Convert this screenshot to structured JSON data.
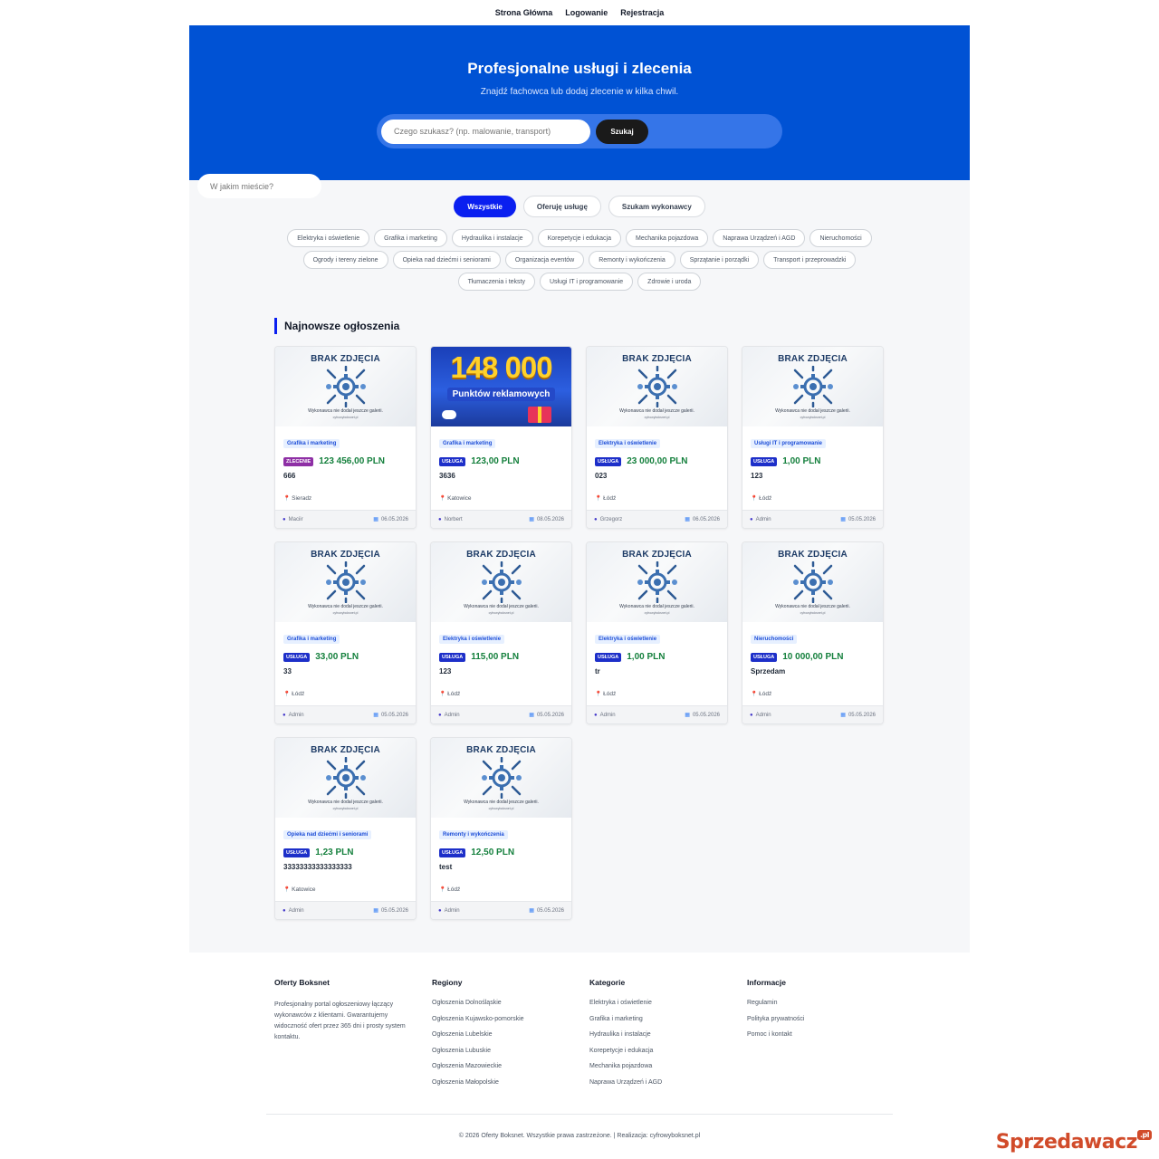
{
  "nav": {
    "home": "Strona Główna",
    "login": "Logowanie",
    "register": "Rejestracja"
  },
  "hero": {
    "title": "Profesjonalne usługi i zlecenia",
    "subtitle": "Znajdź fachowca lub dodaj zlecenie w kilka chwil.",
    "search_placeholder": "Czego szukasz? (np. malowanie, transport)",
    "location_placeholder": "W jakim mieście?",
    "search_button": "Szukaj"
  },
  "tabs": [
    "Wszystkie",
    "Oferuję usługę",
    "Szukam wykonawcy"
  ],
  "categories": [
    "Elektryka i oświetlenie",
    "Grafika i marketing",
    "Hydraulika i instalacje",
    "Korepetycje i edukacja",
    "Mechanika pojazdowa",
    "Naprawa Urządzeń i AGD",
    "Nieruchomości",
    "Ogrody i tereny zielone",
    "Opieka nad dziećmi i seniorami",
    "Organizacja eventów",
    "Remonty i wykończenia",
    "Sprzątanie i porządki",
    "Transport i przeprowadzki",
    "Tłumaczenia i teksty",
    "Usługi IT i programowanie",
    "Zdrowie i uroda"
  ],
  "section_title": "Najnowsze ogłoszenia",
  "placeholder": {
    "heading": "BRAK ZDJĘCIA",
    "text": "Wykonawca nie dodał jeszcze galerii.",
    "watermark": "cyfrowyboksnet.pl"
  },
  "promo": {
    "number": "148 000",
    "label": "Punktów reklamowych"
  },
  "listings": [
    {
      "category": "Grafika i marketing",
      "type": "ZLECENIE",
      "price": "123 456,00 PLN",
      "title": "666",
      "location": "Sieradz",
      "user": "Maciir",
      "date": "06.05.2026",
      "promo": false
    },
    {
      "category": "Grafika i marketing",
      "type": "USŁUGA",
      "price": "123,00 PLN",
      "title": "3636",
      "location": "Katowice",
      "user": "Norbert",
      "date": "08.05.2026",
      "promo": true
    },
    {
      "category": "Elektryka i oświetlenie",
      "type": "USŁUGA",
      "price": "23 000,00 PLN",
      "title": "023",
      "location": "Łódź",
      "user": "Grzegorz",
      "date": "06.05.2026",
      "promo": false
    },
    {
      "category": "Usługi IT i programowanie",
      "type": "USŁUGA",
      "price": "1,00 PLN",
      "title": "123",
      "location": "Łódź",
      "user": "Admin",
      "date": "05.05.2026",
      "promo": false
    },
    {
      "category": "Grafika i marketing",
      "type": "USŁUGA",
      "price": "33,00 PLN",
      "title": "33",
      "location": "Łódź",
      "user": "Admin",
      "date": "05.05.2026",
      "promo": false
    },
    {
      "category": "Elektryka i oświetlenie",
      "type": "USŁUGA",
      "price": "115,00 PLN",
      "title": "123",
      "location": "Łódź",
      "user": "Admin",
      "date": "05.05.2026",
      "promo": false
    },
    {
      "category": "Elektryka i oświetlenie",
      "type": "USŁUGA",
      "price": "1,00 PLN",
      "title": "tr",
      "location": "Łódź",
      "user": "Admin",
      "date": "05.05.2026",
      "promo": false
    },
    {
      "category": "Nieruchomości",
      "type": "USŁUGA",
      "price": "10 000,00 PLN",
      "title": "Sprzedam",
      "location": "Łódź",
      "user": "Admin",
      "date": "05.05.2026",
      "promo": false
    },
    {
      "category": "Opieka nad dziećmi i seniorami",
      "type": "USŁUGA",
      "price": "1,23 PLN",
      "title": "33333333333333333",
      "location": "Katowice",
      "user": "Admin",
      "date": "05.05.2026",
      "promo": false
    },
    {
      "category": "Remonty i wykończenia",
      "type": "USŁUGA",
      "price": "12,50 PLN",
      "title": "test",
      "location": "Łódź",
      "user": "Admin",
      "date": "05.05.2026",
      "promo": false
    }
  ],
  "footer": {
    "about_title": "Oferty Boksnet",
    "about_text": "Profesjonalny portal ogłoszeniowy łączący wykonawców z klientami. Gwarantujemy widoczność ofert przez 365 dni i prosty system kontaktu.",
    "regions_title": "Regiony",
    "regions": [
      "Ogłoszenia Dolnośląskie",
      "Ogłoszenia Kujawsko-pomorskie",
      "Ogłoszenia Lubelskie",
      "Ogłoszenia Lubuskie",
      "Ogłoszenia Mazowieckie",
      "Ogłoszenia Małopolskie"
    ],
    "categories_title": "Kategorie",
    "categories": [
      "Elektryka i oświetlenie",
      "Grafika i marketing",
      "Hydraulika i instalacje",
      "Korepetycje i edukacja",
      "Mechanika pojazdowa",
      "Naprawa Urządzeń i AGD"
    ],
    "info_title": "Informacje",
    "info": [
      "Regulamin",
      "Polityka prywatności",
      "Pomoc i kontakt"
    ],
    "copyright": "© 2026 Oferty Boksnet. Wszystkie prawa zastrzeżone. | Realizacja: cyfrowyboksnet.pl"
  },
  "watermark_brand": "Sprzedawacz",
  "watermark_tld": ".pl",
  "colors": {
    "hero": "#0052d4",
    "accent": "#0a1ff0",
    "price": "#15803d",
    "zlecenie": "#8e2fa5"
  }
}
